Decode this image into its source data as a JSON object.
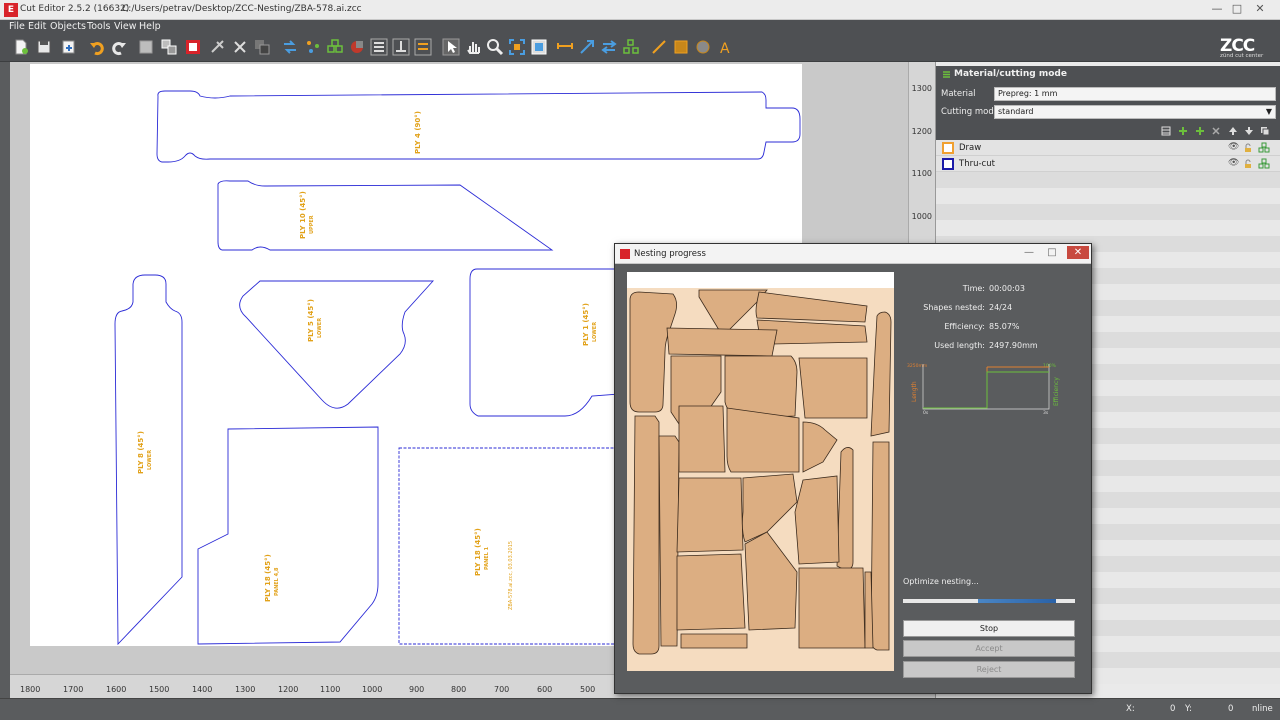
{
  "window": {
    "app_title": "Cut Editor 2.5.2 (16632)",
    "file_path": "C:/Users/petrav/Desktop/ZCC-Nesting/ZBA-578.ai.zcc",
    "min_glyph": "—",
    "max_glyph": "□",
    "close_glyph": "✕"
  },
  "menu": [
    "File",
    "Edit",
    "Objects",
    "Tools",
    "View",
    "Help"
  ],
  "logo": {
    "text": "ZCC",
    "subtitle": "zünd cut center"
  },
  "toolbar_icons": [
    "new-file-icon",
    "save-icon",
    "import-icon",
    "undo-icon",
    "redo-icon",
    "group-icon",
    "ungroup-icon",
    "cut-icon",
    "nest-icon",
    "transform-icon",
    "delete-icon",
    "copy-icon",
    "mirror-icon",
    "nodes-icon",
    "grid-icon",
    "align-left-icon",
    "align-center-icon",
    "align-right-icon",
    "select-icon",
    "pan-icon",
    "zoom-icon",
    "zoom-fit-icon",
    "zoom-all-icon",
    "measure-icon",
    "vector-icon",
    "swap-icon",
    "network-icon",
    "line-icon",
    "rectangle-icon",
    "circle-icon",
    "text-icon"
  ],
  "canvas": {
    "vruler_ticks": [
      "1300",
      "1200",
      "1100",
      "1000"
    ],
    "hruler_ticks": [
      "1800",
      "1700",
      "1600",
      "1500",
      "1400",
      "1300",
      "1200",
      "1100",
      "1000",
      "900",
      "800",
      "700",
      "600",
      "500"
    ],
    "shape_labels": [
      {
        "main": "PLY 4 (90°)",
        "sub": ""
      },
      {
        "main": "PLY 10 (45°)",
        "sub": "UPPER"
      },
      {
        "main": "PLY 5 (45°)",
        "sub": "LOWER"
      },
      {
        "main": "PLY 1 (45°)",
        "sub": "LOWER"
      },
      {
        "main": "PLY 8 (45°)",
        "sub": "LOWER"
      },
      {
        "main": "PLY 18 (45°)",
        "sub": "PANEL 4,8"
      },
      {
        "main": "PLY 18 (45°)",
        "sub": "PANEL 1"
      },
      {
        "main": "ZBA-578.ai.zcc, 03.03.2015",
        "sub": ""
      }
    ],
    "label_color": "#e2a21a",
    "shape_color": "#2b2bd6"
  },
  "panel": {
    "title": "Material/cutting mode",
    "material_label": "Material",
    "material_value": "Prepreg: 1 mm",
    "mode_label": "Cutting mode",
    "mode_value": "standard",
    "layers": [
      {
        "name": "Draw",
        "color": "#f0a030"
      },
      {
        "name": "Thru-cut",
        "color": "#1a1aa8"
      }
    ]
  },
  "dialog": {
    "title": "Nesting progress",
    "stats": [
      {
        "label": "Time:",
        "value": "00:00:03"
      },
      {
        "label": "Shapes nested:",
        "value": "24/24"
      },
      {
        "label": "Efficiency:",
        "value": "85.07%"
      },
      {
        "label": "Used length:",
        "value": "2497.90mm"
      }
    ],
    "chart": {
      "length_label": "Length",
      "efficiency_label": "Efficiency",
      "top_left": "3250mm",
      "top_right": "100%",
      "bottom_left": "0s",
      "bottom_right": "3s"
    },
    "status_text": "Optimize nesting...",
    "progress": 0.45,
    "buttons": {
      "stop": "Stop",
      "accept": "Accept",
      "reject": "Reject"
    }
  },
  "statusbar": {
    "x_label": "X:",
    "x_value": "0",
    "y_label": "Y:",
    "y_value": "0",
    "mode": "nline"
  }
}
